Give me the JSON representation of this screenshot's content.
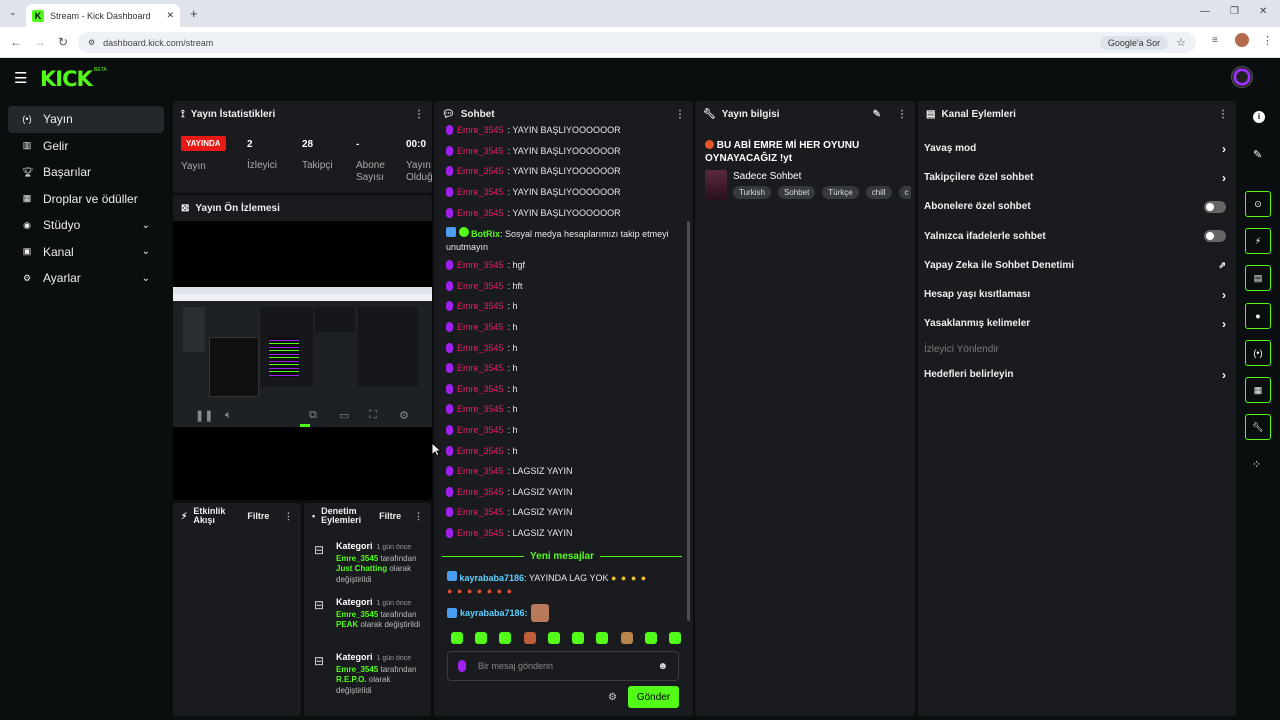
{
  "browser": {
    "tab_title": "Stream - Kick Dashboard",
    "url": "dashboard.kick.com/stream",
    "google_ask": "Google'a Sor"
  },
  "header": {
    "logo": "KICK",
    "beta": "BETA"
  },
  "sidebar": {
    "items": [
      {
        "label": "Yayın",
        "icon": "broadcast-icon"
      },
      {
        "label": "Gelir",
        "icon": "chart-icon"
      },
      {
        "label": "Başarılar",
        "icon": "trophy-icon"
      },
      {
        "label": "Droplar ve ödüller",
        "icon": "gift-icon"
      },
      {
        "label": "Stüdyo",
        "icon": "studio-icon"
      },
      {
        "label": "Kanal",
        "icon": "channel-icon"
      },
      {
        "label": "Ayarlar",
        "icon": "gear-icon"
      }
    ]
  },
  "stats": {
    "title": "Yayın İstatistikleri",
    "live": "YAYINDA",
    "live_label": "Yayın",
    "viewers_value": "2",
    "viewers_label": "İzleyici",
    "followers_value": "28",
    "followers_label": "Takipçi",
    "subs_value": "-",
    "subs_label": "Abone Sayısı",
    "time_value": "00:0",
    "time_label": "Yayın Olduğ"
  },
  "preview": {
    "title": "Yayın Ön İzlemesi"
  },
  "activity": {
    "title": "Etkinlik Akışı",
    "filter": "Filtre"
  },
  "moderation": {
    "title": "Denetim Eylemleri",
    "filter": "Filtre",
    "items": [
      {
        "title": "Kategori",
        "time": "1 gün önce",
        "user": "Emre_3545",
        "by": "tarafından",
        "value": "Just Chatting",
        "suffix": "olarak değiştirildi"
      },
      {
        "title": "Kategori",
        "time": "1 gün önce",
        "user": "Emre_3545",
        "by": "tarafından",
        "value": "PEAK",
        "suffix": "olarak değiştirildi"
      },
      {
        "title": "Kategori",
        "time": "1 gün önce",
        "user": "Emre_3545",
        "by": "tarafından",
        "value": "R.E.P.O.",
        "suffix": "olarak değiştirildi"
      }
    ]
  },
  "chat": {
    "title": "Sohbet",
    "messages": [
      {
        "user": "Emre_3545",
        "text": ": YAYIN BAŞLIYOOOOOOR"
      },
      {
        "user": "Emre_3545",
        "text": ": YAYIN BAŞLIYOOOOOOR"
      },
      {
        "user": "Emre_3545",
        "text": ": YAYIN BAŞLIYOOOOOOR"
      },
      {
        "user": "Emre_3545",
        "text": ": YAYIN BAŞLIYOOOOOOR"
      },
      {
        "user": "Emre_3545",
        "text": ": YAYIN BAŞLIYOOOOOOR"
      }
    ],
    "bot_user": "BotRix",
    "bot_text": ": Sosyal medya hesaplarımızı takip etmeyi unutmayın",
    "messages2": [
      {
        "user": "Emre_3545",
        "text": ": hgf"
      },
      {
        "user": "Emre_3545",
        "text": ": hft"
      },
      {
        "user": "Emre_3545",
        "text": ": h"
      },
      {
        "user": "Emre_3545",
        "text": ": h"
      },
      {
        "user": "Emre_3545",
        "text": ": h"
      },
      {
        "user": "Emre_3545",
        "text": ": h"
      },
      {
        "user": "Emre_3545",
        "text": ": h"
      },
      {
        "user": "Emre_3545",
        "text": ": h"
      },
      {
        "user": "Emre_3545",
        "text": ": h"
      },
      {
        "user": "Emre_3545",
        "text": ": h"
      },
      {
        "user": "Emre_3545",
        "text": ": LAGSIZ YAYIN"
      },
      {
        "user": "Emre_3545",
        "text": ": LAGSIZ YAYIN"
      },
      {
        "user": "Emre_3545",
        "text": ": LAGSIZ YAYIN"
      },
      {
        "user": "Emre_3545",
        "text": ": LAGSIZ YAYIN"
      }
    ],
    "new_messages": "Yeni mesajlar",
    "k_user": "kayrababa7186",
    "k_text": ": YAYINDA LAG YOK",
    "k_user2": "kayrababa7186:",
    "placeholder": "Bir mesaj gönderin",
    "send": "Gönder"
  },
  "stream_info": {
    "title": "Yayın bilgisi",
    "stream_title": "BU ABİ EMRE Mİ  HER OYUNU OYNAYACAĞIZ !yt",
    "category": "Sadece Sohbet",
    "tags": [
      "Turkish",
      "Sohbet",
      "Türkçe",
      "chill",
      "c"
    ]
  },
  "channel_actions": {
    "title": "Kanal Eylemleri",
    "items": [
      {
        "label": "Yavaş mod",
        "type": "arrow"
      },
      {
        "label": "Takipçilere özel sohbet",
        "type": "arrow"
      },
      {
        "label": "Abonelere özel sohbet",
        "type": "toggle"
      },
      {
        "label": "Yalnızca ifadelerle sohbet",
        "type": "toggle"
      },
      {
        "label": "Yapay Zeka ile Sohbet Denetimi",
        "type": "external"
      },
      {
        "label": "Hesap yaşı kısıtlaması",
        "type": "arrow"
      },
      {
        "label": "Yasaklanmış kelimeler",
        "type": "arrow"
      },
      {
        "label": "İzleyici Yönlendir",
        "type": "disabled"
      },
      {
        "label": "Hedefleri belirleyin",
        "type": "arrow"
      }
    ]
  }
}
